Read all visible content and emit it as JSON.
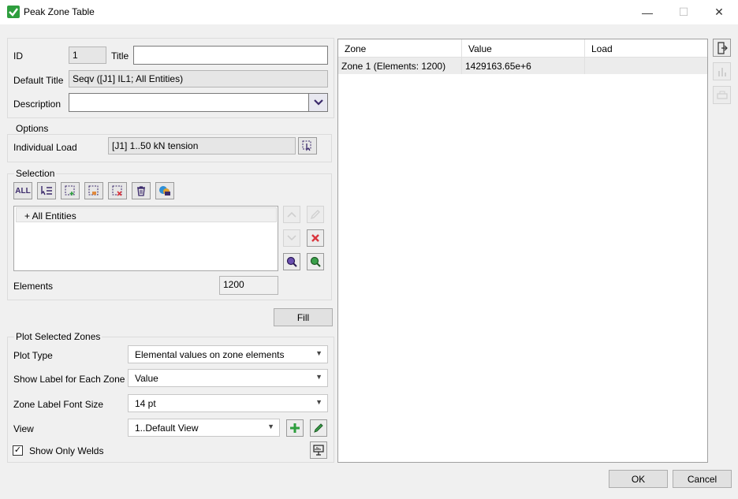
{
  "window": {
    "title": "Peak Zone Table",
    "minimize_glyph": "—",
    "maximize_glyph": "☐",
    "close_glyph": "✕"
  },
  "general": {
    "id_label": "ID",
    "id_value": "1",
    "title_label": "Title",
    "title_value": "",
    "default_title_label": "Default Title",
    "default_title_value": "Seqv ([J1] IL1; All Entities)",
    "description_label": "Description",
    "description_value": ""
  },
  "options": {
    "group_label": "Options",
    "individual_load_label": "Individual Load",
    "individual_load_value": "[J1] 1..50 kN tension"
  },
  "selection": {
    "group_label": "Selection",
    "toolbar": {
      "all_label": "ALL"
    },
    "items": [
      "+ All Entities"
    ],
    "elements_label": "Elements",
    "elements_value": "1200"
  },
  "fill_button": "Fill",
  "plot": {
    "group_label": "Plot Selected Zones",
    "plot_type_label": "Plot Type",
    "plot_type_value": "Elemental values on zone elements",
    "show_label_label": "Show Label for Each Zone",
    "show_label_value": "Value",
    "font_size_label": "Zone Label Font Size",
    "font_size_value": "14 pt",
    "view_label": "View",
    "view_value": "1..Default View",
    "show_only_welds_label": "Show Only Welds",
    "show_only_welds_checked": true
  },
  "table": {
    "columns": [
      "Zone",
      "Value",
      "Load"
    ],
    "rows": [
      [
        "Zone 1 (Elements: 1200)",
        "1429163.65e+6",
        ""
      ]
    ]
  },
  "footer": {
    "ok_label": "OK",
    "cancel_label": "Cancel"
  },
  "colors": {
    "accent_green": "#2e9e3e",
    "icon_purple": "#3b2a6b",
    "delete_red": "#d9363e"
  }
}
